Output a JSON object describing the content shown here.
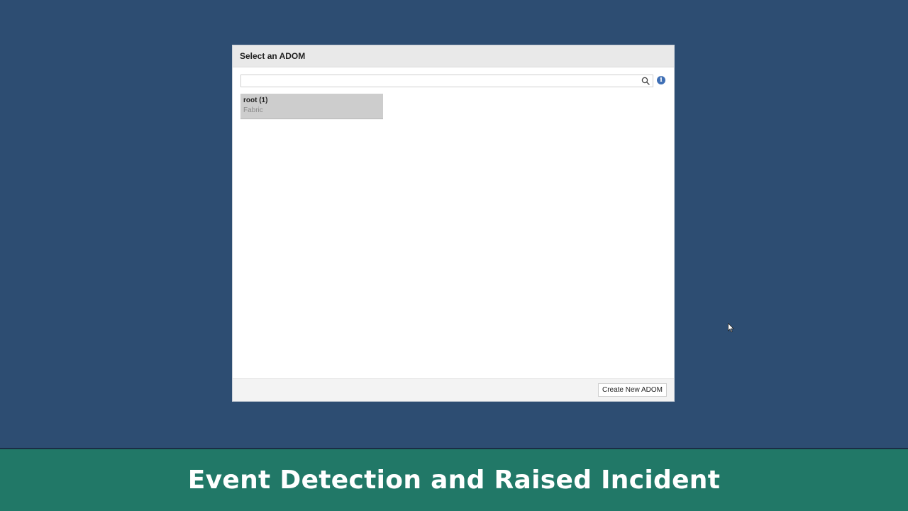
{
  "dialog": {
    "title": "Select an ADOM",
    "search": {
      "value": "",
      "placeholder": ""
    },
    "adoms": [
      {
        "name": "root (1)",
        "type": "Fabric"
      }
    ],
    "footer": {
      "create_button_label": "Create New ADOM"
    }
  },
  "icons": {
    "search": "search-icon",
    "info": "info-icon",
    "cursor": "mouse-pointer-icon"
  },
  "banner": {
    "text": "Event Detection and Raised Incident"
  },
  "colors": {
    "background": "#2d4d72",
    "banner": "#217867",
    "tile": "#cdcdcd",
    "info_icon": "#3f6fb5"
  }
}
